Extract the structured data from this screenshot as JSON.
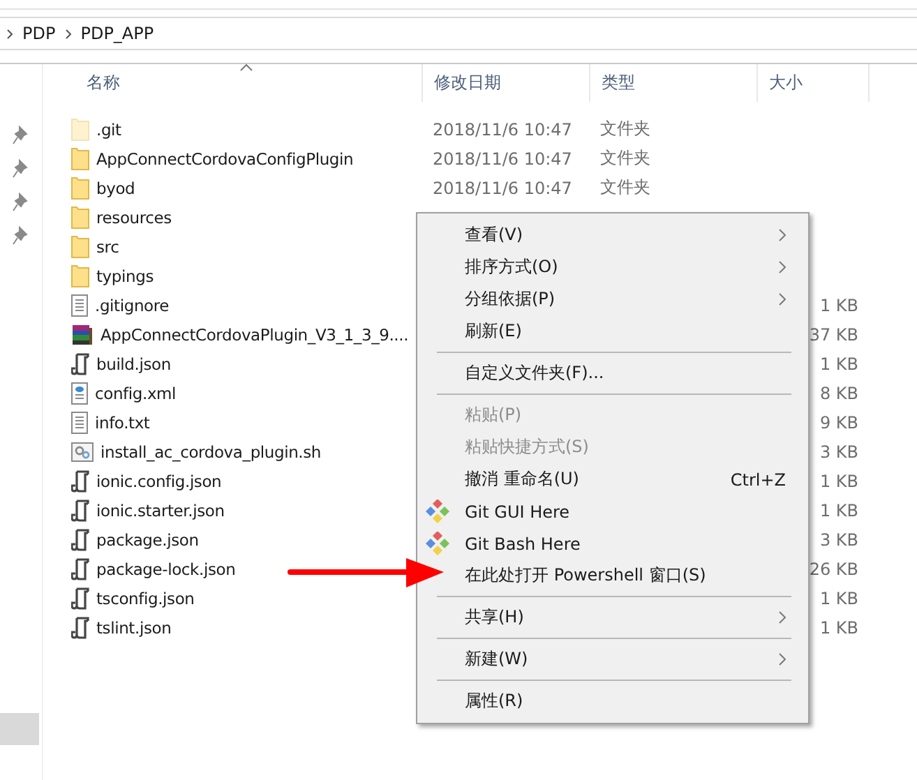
{
  "breadcrumb": [
    "PDP",
    "PDP_APP"
  ],
  "columns": [
    {
      "label": "名称",
      "sorted": true
    },
    {
      "label": "修改日期",
      "sorted": false
    },
    {
      "label": "类型",
      "sorted": false
    },
    {
      "label": "大小",
      "sorted": false
    }
  ],
  "files": [
    {
      "name": ".git",
      "kind": "folder",
      "hidden": true,
      "date": "2018/11/6 10:47",
      "type": "文件夹"
    },
    {
      "name": "AppConnectCordovaConfigPlugin",
      "kind": "folder",
      "hidden": false,
      "date": "2018/11/6 10:47",
      "type": "文件夹"
    },
    {
      "name": "byod",
      "kind": "folder",
      "hidden": false,
      "date": "2018/11/6 10:47",
      "type": "文件夹"
    },
    {
      "name": "resources",
      "kind": "folder",
      "hidden": false
    },
    {
      "name": "src",
      "kind": "folder",
      "hidden": false
    },
    {
      "name": "typings",
      "kind": "folder",
      "hidden": false
    },
    {
      "name": ".gitignore",
      "kind": "text",
      "hidden": false,
      "size": "1 KB"
    },
    {
      "name": "AppConnectCordovaPlugin_V3_1_3_9....",
      "kind": "archive",
      "hidden": false,
      "size": "37 KB"
    },
    {
      "name": "build.json",
      "kind": "json",
      "hidden": false,
      "size": "1 KB"
    },
    {
      "name": "config.xml",
      "kind": "xml",
      "hidden": false,
      "size": "8 KB"
    },
    {
      "name": "info.txt",
      "kind": "text",
      "hidden": false,
      "size": "9 KB"
    },
    {
      "name": "install_ac_cordova_plugin.sh",
      "kind": "script",
      "hidden": false,
      "size": "3 KB"
    },
    {
      "name": "ionic.config.json",
      "kind": "json",
      "hidden": false,
      "size": "1 KB"
    },
    {
      "name": "ionic.starter.json",
      "kind": "json",
      "hidden": false,
      "size": "1 KB"
    },
    {
      "name": "package.json",
      "kind": "json",
      "hidden": false,
      "size": "3 KB"
    },
    {
      "name": "package-lock.json",
      "kind": "json",
      "hidden": false,
      "size": "26 KB"
    },
    {
      "name": "tsconfig.json",
      "kind": "json",
      "hidden": false,
      "size": "1 KB"
    },
    {
      "name": "tslint.json",
      "kind": "json",
      "hidden": false,
      "size": "1 KB"
    }
  ],
  "context_menu": [
    {
      "kind": "item",
      "label": "查看(V)",
      "submenu": true,
      "disabled": false
    },
    {
      "kind": "item",
      "label": "排序方式(O)",
      "submenu": true,
      "disabled": false
    },
    {
      "kind": "item",
      "label": "分组依据(P)",
      "submenu": true,
      "disabled": false
    },
    {
      "kind": "item",
      "label": "刷新(E)",
      "submenu": false,
      "disabled": false
    },
    {
      "kind": "separator"
    },
    {
      "kind": "item",
      "label": "自定义文件夹(F)...",
      "submenu": false,
      "disabled": false
    },
    {
      "kind": "separator"
    },
    {
      "kind": "item",
      "label": "粘贴(P)",
      "submenu": false,
      "disabled": true
    },
    {
      "kind": "item",
      "label": "粘贴快捷方式(S)",
      "submenu": false,
      "disabled": true
    },
    {
      "kind": "item",
      "label": "撤消 重命名(U)",
      "shortcut": "Ctrl+Z",
      "submenu": false,
      "disabled": false
    },
    {
      "kind": "git",
      "label": "Git GUI Here",
      "submenu": false,
      "disabled": false
    },
    {
      "kind": "git",
      "label": "Git Bash Here",
      "submenu": false,
      "disabled": false
    },
    {
      "kind": "item",
      "label": "在此处打开 Powershell 窗口(S)",
      "submenu": false,
      "disabled": false
    },
    {
      "kind": "separator"
    },
    {
      "kind": "item",
      "label": "共享(H)",
      "submenu": true,
      "disabled": false
    },
    {
      "kind": "separator"
    },
    {
      "kind": "item",
      "label": "新建(W)",
      "submenu": true,
      "disabled": false
    },
    {
      "kind": "separator"
    },
    {
      "kind": "item",
      "label": "属性(R)",
      "submenu": false,
      "disabled": false
    }
  ]
}
